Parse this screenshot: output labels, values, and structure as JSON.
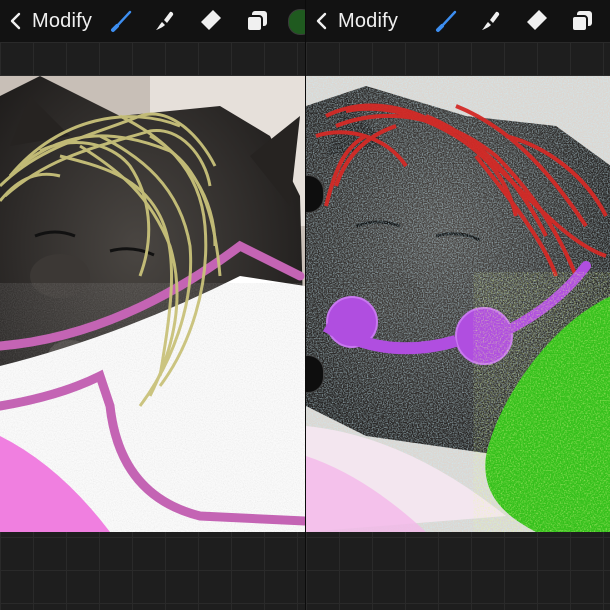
{
  "panes": [
    {
      "back_label": "Modify",
      "tools": [
        {
          "name": "brush-icon",
          "active": true
        },
        {
          "name": "smudge-icon",
          "active": false
        },
        {
          "name": "eraser-icon",
          "active": false
        },
        {
          "name": "layers-icon",
          "active": false
        },
        {
          "name": "color-swatch",
          "active": false
        }
      ]
    },
    {
      "back_label": "Modify",
      "tools": [
        {
          "name": "brush-icon",
          "active": true
        },
        {
          "name": "smudge-icon",
          "active": false
        },
        {
          "name": "eraser-icon",
          "active": false
        },
        {
          "name": "layers-icon",
          "active": false
        }
      ]
    }
  ],
  "colors": {
    "accent": "#3d8ef0",
    "swatch": "#1f5a1f",
    "hair_yellow": "#c9c27a",
    "hair_red": "#d42a26",
    "collar_purple": "#b04ee0",
    "blob_green": "#35c01c",
    "outline_pink": "#c464b4"
  }
}
